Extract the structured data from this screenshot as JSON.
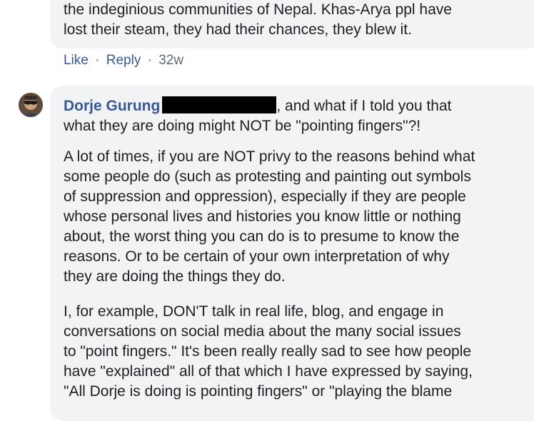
{
  "previous_comment": {
    "lines": [
      "the indeginious communities of Nepal. Khas-Arya ppl have",
      "lost their steam, they had their chances, they blew it."
    ],
    "actions": {
      "like": "Like",
      "reply": "Reply",
      "separator": "·",
      "time": "32w"
    }
  },
  "comment": {
    "author": "Dorje Gurung",
    "first_lines": [
      ", and what if I told you that",
      "what they are doing might NOT be \"pointing fingers\"?!"
    ],
    "paragraph2": [
      "A lot of times, if you are NOT privy to the reasons behind what",
      "some people do (such as protesting and painting out symbols",
      "of suppression and oppression), especially if they are people",
      "whose personal lives and histories you know little or nothing",
      "about, the worst thing you can do is to presume to know the",
      "reasons. Or to be certain of your own interpretation of why",
      "they are doing the things they do."
    ],
    "paragraph3": [
      "I, for example, DON'T talk in real life, blog, and engage in",
      "conversations on social media about the many social issues",
      "to \"point fingers.\" It's been really really sad to see how people",
      "have \"explained\" all of that which I have expressed by saying,",
      "\"All Dorje is doing is pointing fingers\" or \"playing the blame"
    ]
  }
}
